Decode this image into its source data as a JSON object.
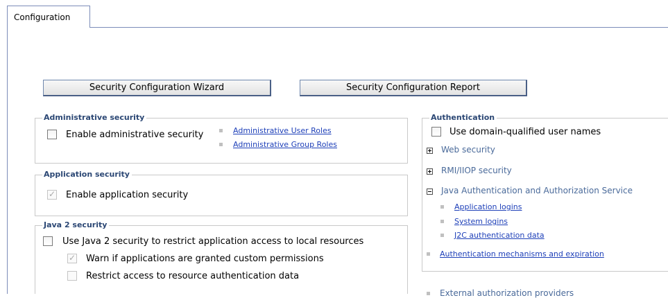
{
  "tabs": {
    "configuration": "Configuration"
  },
  "buttons": {
    "wizard": "Security Configuration Wizard",
    "report": "Security Configuration Report"
  },
  "admin_security": {
    "legend": "Administrative security",
    "checkbox_label": "Enable administrative security",
    "checked": false,
    "links": [
      "Administrative User Roles",
      "Administrative Group Roles"
    ]
  },
  "app_security": {
    "legend": "Application security",
    "checkbox_label": "Enable application security",
    "checked": true,
    "disabled": true
  },
  "java2_security": {
    "legend": "Java 2 security",
    "main_label": "Use Java 2 security to restrict application access to local resources",
    "warn_label": "Warn if applications are granted custom permissions",
    "warn_checked": true,
    "restrict_label": "Restrict access to resource authentication data",
    "restrict_checked": false
  },
  "authentication": {
    "legend": "Authentication",
    "domain_label": "Use domain-qualified user names",
    "web_security": "Web security",
    "rmi_security": "RMI/IIOP security",
    "jaas": "Java Authentication and Authorization Service",
    "jaas_links": [
      "Application logins",
      "System logins",
      "J2C authentication data"
    ],
    "mechanisms_link": "Authentication mechanisms and expiration",
    "external_link_partial": "External authorization providers"
  },
  "colors": {
    "link": "#1d3fb8",
    "legend": "#2b4774",
    "border": "#c9c9c9",
    "tab_border": "#7b8cb8"
  }
}
